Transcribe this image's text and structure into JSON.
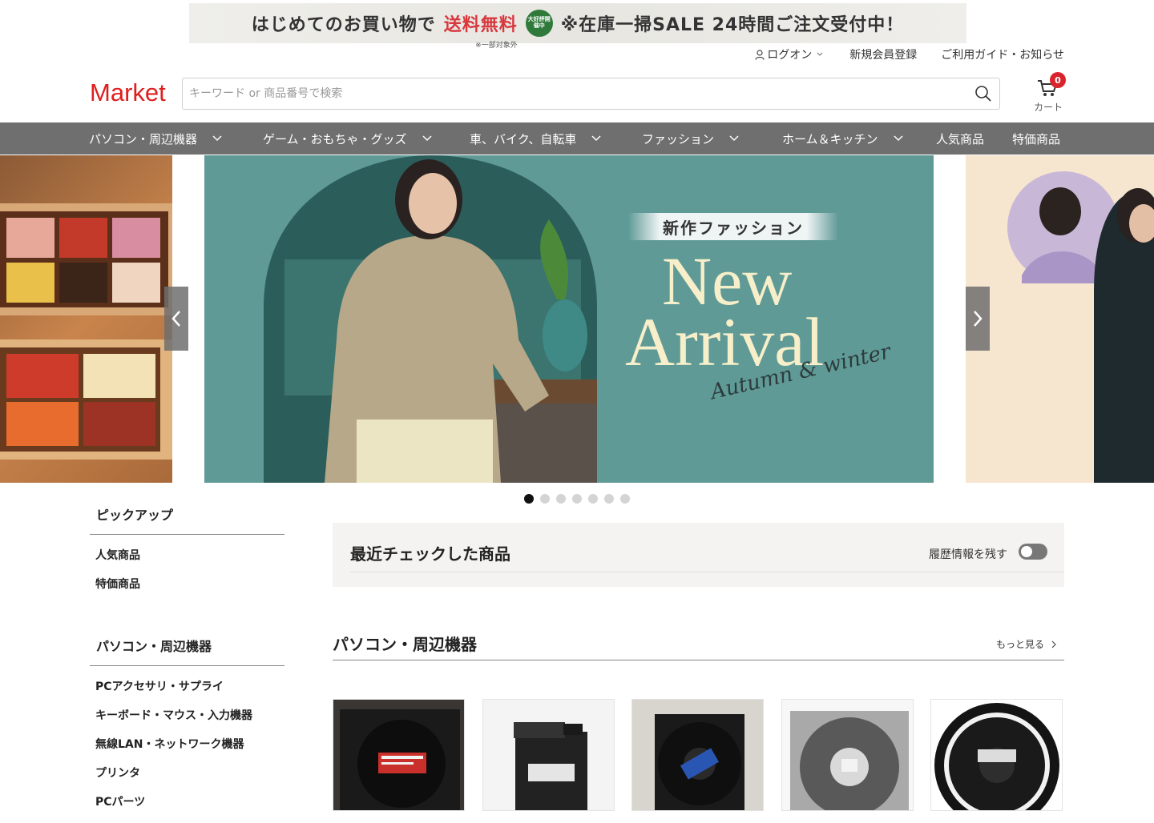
{
  "promo": {
    "part1": "はじめてのお買い物で",
    "part2": "送料無料",
    "note": "※一部対象外",
    "badge": "大好評開催中",
    "part3": "※在庫一掃SALE 24時間ご注文受付中！"
  },
  "utility": {
    "login": "ログオン",
    "register": "新規会員登録",
    "guide": "ご利用ガイド・お知らせ"
  },
  "header": {
    "logo": "Market",
    "search_placeholder": "キーワード or 商品番号で検索",
    "cart_count": "0",
    "cart_label": "カート"
  },
  "nav": [
    {
      "label": "パソコン・周辺機器"
    },
    {
      "label": "ゲーム・おもちゃ・グッズ"
    },
    {
      "label": "車、バイク、自転車"
    },
    {
      "label": "ファッション"
    },
    {
      "label": "ホーム＆キッチン"
    },
    {
      "label": "人気商品"
    },
    {
      "label": "特価商品"
    }
  ],
  "hero": {
    "label": "新作ファッション",
    "big1": "New",
    "big2": "Arrival",
    "script": "Autumn & winter",
    "slide_count": 7,
    "active_slide": 1
  },
  "sidebar": {
    "pickup": {
      "title": "ピックアップ",
      "items": [
        "人気商品",
        "特価商品"
      ]
    },
    "pc": {
      "title": "パソコン・周辺機器",
      "items": [
        "PCアクセサリ・サプライ",
        "キーボード・マウス・入力機器",
        "無線LAN・ネットワーク機器",
        "プリンタ",
        "PCパーツ"
      ]
    }
  },
  "recent": {
    "title": "最近チェックした商品",
    "history_label": "履歴情報を残す",
    "history_on": false
  },
  "section": {
    "title": "パソコン・周辺機器",
    "more": "もっと見る"
  },
  "colors": {
    "accent_red": "#e01e1e",
    "nav_bg": "#6f6f6f",
    "hero_teal": "#5f9a97"
  }
}
